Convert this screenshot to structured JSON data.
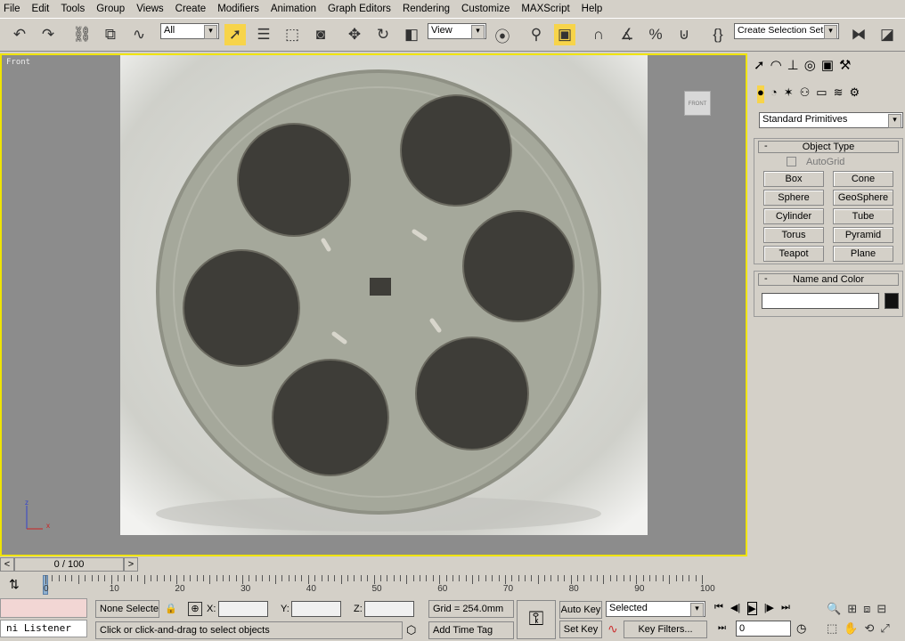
{
  "menu": [
    "File",
    "Edit",
    "Tools",
    "Group",
    "Views",
    "Create",
    "Modifiers",
    "Animation",
    "Graph Editors",
    "Rendering",
    "Customize",
    "MAXScript",
    "Help"
  ],
  "toolbar": {
    "filter": "All",
    "ref_coord": "View",
    "selection_set": "Create Selection Set"
  },
  "viewport": {
    "label": "Front",
    "viewcube_label": "FRONT",
    "axis_z": "z",
    "axis_x": "x"
  },
  "command_panel": {
    "category": "Standard Primitives",
    "object_type": {
      "title": "Object Type",
      "autogrid": "AutoGrid",
      "buttons": [
        "Box",
        "Cone",
        "Sphere",
        "GeoSphere",
        "Cylinder",
        "Tube",
        "Torus",
        "Pyramid",
        "Teapot",
        "Plane"
      ]
    },
    "name_color": {
      "title": "Name and Color",
      "name": "",
      "color": "#111111"
    }
  },
  "timeslider": {
    "value": "0 / 100",
    "prev": "<",
    "next": ">"
  },
  "trackbar": {
    "ticks": [
      "0",
      "10",
      "20",
      "30",
      "40",
      "50",
      "60",
      "70",
      "80",
      "90",
      "100"
    ]
  },
  "status": {
    "listener": "ni Listener",
    "selection": "None Selecte",
    "x_label": "X:",
    "y_label": "Y:",
    "z_label": "Z:",
    "grid": "Grid = 254.0mm",
    "prompt": "Click or click-and-drag to select objects",
    "add_time_tag": "Add Time Tag"
  },
  "anim": {
    "auto_key": "Auto Key",
    "set_key": "Set Key",
    "key_mode": "Selected",
    "key_filters": "Key Filters...",
    "frame": "0"
  }
}
